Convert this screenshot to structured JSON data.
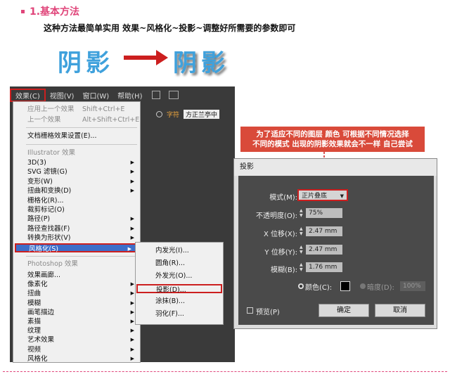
{
  "heading": {
    "number_title": "1.基本方法",
    "description": "这种方法最简单实用   效果~风格化~投影~调整好所需要的参数即可"
  },
  "demo": {
    "plain_text": "阴影",
    "shadow_text": "阴影"
  },
  "menubar": {
    "items": [
      "效果(C)",
      "视图(V)",
      "窗口(W)",
      "帮助(H)"
    ]
  },
  "toolbar": {
    "font_button": "字符",
    "font_name": "方正兰亭中"
  },
  "effect_menu": {
    "apply_last": "应用上一个效果",
    "apply_last_shortcut": "Shift+Ctrl+E",
    "last_effect": "上一个效果",
    "last_effect_shortcut": "Alt+Shift+Ctrl+E",
    "raster_settings": "文档栅格效果设置(E)...",
    "illustrator_header": "Illustrator 效果",
    "illustrator_items": [
      "3D(3)",
      "SVG 滤镜(G)",
      "变形(W)",
      "扭曲和变换(D)",
      "栅格化(R)...",
      "裁剪标记(O)",
      "路径(P)",
      "路径查找器(F)",
      "转换为形状(V)",
      "风格化(S)"
    ],
    "photoshop_header": "Photoshop 效果",
    "photoshop_items": [
      "效果画廊...",
      "像素化",
      "扭曲",
      "模糊",
      "画笔描边",
      "素描",
      "纹理",
      "艺术效果",
      "视频",
      "风格化"
    ]
  },
  "stylize_submenu": {
    "items": [
      "内发光(I)...",
      "圆角(R)...",
      "外发光(O)...",
      "投影(D)...",
      "涂抹(B)...",
      "羽化(F)..."
    ]
  },
  "note": {
    "line1": "为了适应不同的图层 颜色 可根据不同情况选择",
    "line2": "不同的模式 出现的阴影效果就会不一样 自己尝试"
  },
  "dialog": {
    "title": "投影",
    "mode_label": "模式(M):",
    "mode_value": "正片叠底",
    "opacity_label": "不透明度(O):",
    "opacity_value": "75%",
    "x_label": "X 位移(X):",
    "x_value": "2.47 mm",
    "y_label": "Y 位移(Y):",
    "y_value": "2.47 mm",
    "blur_label": "模糊(B):",
    "blur_value": "1.76 mm",
    "color_label": "颜色(C):",
    "darkness_label": "暗度(D):",
    "darkness_value": "100%",
    "preview_label": "预览(P)",
    "ok_label": "确定",
    "cancel_label": "取消"
  },
  "colors": {
    "accent_pink": "#e0457a",
    "title_blue": "#3fa1dc",
    "highlight_red": "#cc1f1f",
    "note_bg": "#d94a3a"
  }
}
